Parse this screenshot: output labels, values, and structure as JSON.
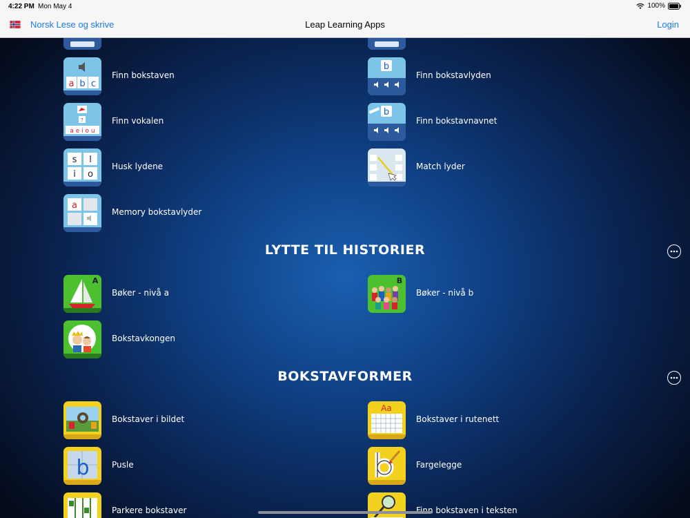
{
  "status_bar": {
    "time": "4:22 PM",
    "date": "Mon May 4",
    "battery": "100%"
  },
  "nav": {
    "back_label": "Norsk Lese og skrive",
    "title": "Leap Learning Apps",
    "login_label": "Login"
  },
  "top_items": [
    {
      "label": "Finn bokstaven",
      "icon": "abc-sound-icon"
    },
    {
      "label": "Finn bokstavlyden",
      "icon": "letter-b-sound-icon"
    },
    {
      "label": "Finn vokalen",
      "icon": "vowel-icon"
    },
    {
      "label": "Finn bokstavnavnet",
      "icon": "letter-name-icon"
    },
    {
      "label": "Husk lydene",
      "icon": "memory-letters-icon"
    },
    {
      "label": "Match lyder",
      "icon": "match-sounds-icon"
    },
    {
      "label": "Memory bokstavlyder",
      "icon": "memory-sound-icon"
    }
  ],
  "section_stories": {
    "title": "LYTTE TIL HISTORIER"
  },
  "story_items": [
    {
      "label": "Bøker - nivå a",
      "icon": "sailboat-book-icon"
    },
    {
      "label": "Bøker - nivå b",
      "icon": "children-book-icon"
    },
    {
      "label": "Bokstavkongen",
      "icon": "king-icon"
    }
  ],
  "section_shapes": {
    "title": "BOKSTAVFORMER"
  },
  "shape_items": [
    {
      "label": "Bokstaver i bildet",
      "icon": "picture-letters-icon"
    },
    {
      "label": "Bokstaver i rutenett",
      "icon": "letter-grid-icon"
    },
    {
      "label": "Pusle",
      "icon": "puzzle-icon"
    },
    {
      "label": "Fargelegge",
      "icon": "coloring-icon"
    },
    {
      "label": "Parkere bokstaver",
      "icon": "parking-icon"
    },
    {
      "label": "Finn bokstaven i teksten",
      "icon": "magnifier-text-icon"
    }
  ],
  "colors": {
    "accent": "#1a7ce6",
    "blue_tile": "#6fc4ea",
    "green_tile": "#3fae2a",
    "yellow_tile": "#f2d21e"
  }
}
